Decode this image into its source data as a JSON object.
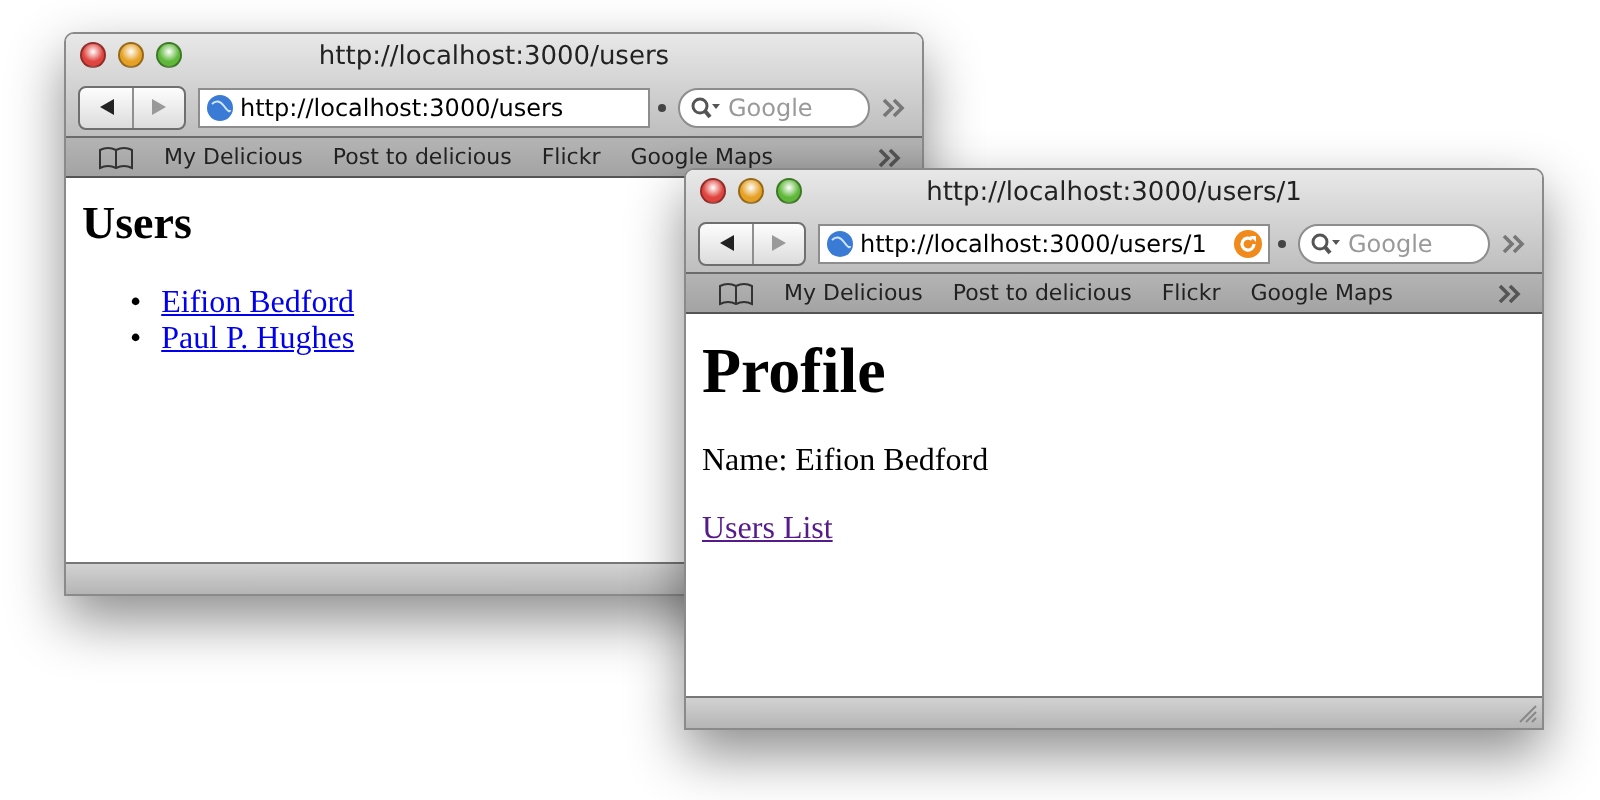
{
  "windows": [
    {
      "title": "http://localhost:3000/users",
      "url": "http://localhost:3000/users",
      "reload_button": false,
      "search": {
        "placeholder": "Google"
      },
      "bookmarks": [
        "My Delicious",
        "Post to delicious",
        "Flickr",
        "Google Maps"
      ],
      "content": [
        {
          "kind": "heading",
          "text": "Users"
        },
        {
          "kind": "list",
          "items": [
            {
              "marker": "•",
              "text": "Eifion Bedford",
              "visited": false
            },
            {
              "marker": "•",
              "text": "Paul P. Hughes",
              "visited": false
            }
          ]
        }
      ]
    },
    {
      "title": "http://localhost:3000/users/1",
      "url": "http://localhost:3000/users/1",
      "reload_button": true,
      "search": {
        "placeholder": "Google"
      },
      "bookmarks": [
        "My Delicious",
        "Post to delicious",
        "Flickr",
        "Google Maps"
      ],
      "content": [
        {
          "kind": "title",
          "text": "Profile"
        },
        {
          "kind": "paragraph",
          "text": "Name: Eifion Bedford"
        },
        {
          "kind": "link",
          "text": "Users List",
          "visited": true
        }
      ]
    }
  ]
}
